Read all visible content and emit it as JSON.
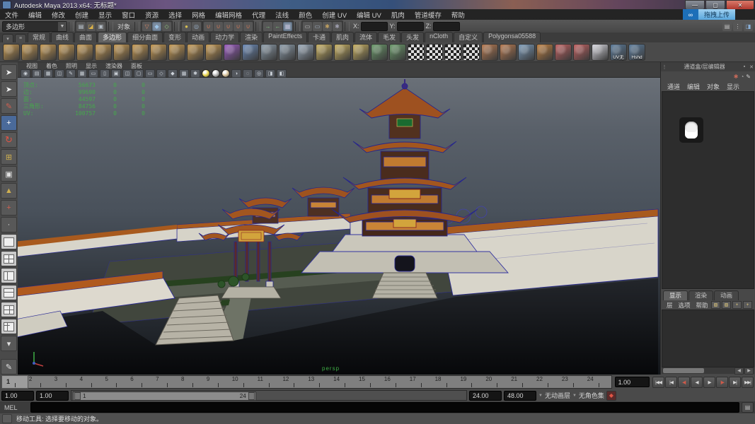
{
  "window": {
    "title": "Autodesk Maya 2013 x64: 无标题*"
  },
  "titlebar_controls": [
    {
      "name": "minimize-button",
      "glyph": "—"
    },
    {
      "name": "maximize-button",
      "glyph": "▢"
    },
    {
      "name": "close-button",
      "glyph": "✕"
    }
  ],
  "upload_button": {
    "label": "拖拽上传"
  },
  "menus": [
    "文件",
    "编辑",
    "修改",
    "创建",
    "显示",
    "窗口",
    "资源",
    "选择",
    "网格",
    "编辑网格",
    "代理",
    "法线",
    "颜色",
    "创建 UV",
    "编辑 UV",
    "肌肉",
    "管道缓存",
    "帮助"
  ],
  "status_line": {
    "menu_set": "多边形",
    "object_mode_label": "对象",
    "file_icons": [
      {
        "name": "new-scene-icon",
        "glyph": "▤",
        "c": "#c8d2dc"
      },
      {
        "name": "open-scene-icon",
        "glyph": "◪",
        "c": "#d9b24a"
      },
      {
        "name": "save-scene-icon",
        "glyph": "▣",
        "c": "#b8c0c8"
      }
    ],
    "mode_icons": [
      {
        "name": "select-by-hierarchy-icon",
        "glyph": "▽",
        "c": "#d88a6a",
        "active": false
      },
      {
        "name": "select-by-object-icon",
        "glyph": "◆",
        "c": "#9cc4e8",
        "active": true
      },
      {
        "name": "select-by-component-icon",
        "glyph": "◇",
        "c": "#8cc47c",
        "active": false
      }
    ],
    "lock_icons": [
      {
        "name": "lock-selection-icon",
        "glyph": "●",
        "c": "#d8c050",
        "active": false
      },
      {
        "name": "highlight-selection-icon",
        "glyph": "◎",
        "c": "#9ab0c8",
        "active": false
      }
    ],
    "snap_icons": [
      {
        "name": "snap-to-grid-icon",
        "glyph": "∪",
        "c": "#d07858",
        "active": false
      },
      {
        "name": "snap-to-curve-icon",
        "glyph": "∪",
        "c": "#d07858",
        "active": false
      },
      {
        "name": "snap-to-point-icon",
        "glyph": "∪",
        "c": "#d07858",
        "active": false
      },
      {
        "name": "snap-to-view-plane-icon",
        "glyph": "∪",
        "c": "#d07858",
        "active": false
      },
      {
        "name": "snap-to-surface-icon",
        "glyph": "∪",
        "c": "#d07858",
        "active": false
      }
    ],
    "history_icons": [
      {
        "name": "input-connections-icon",
        "glyph": "→",
        "c": "#7ec87e",
        "active": false
      },
      {
        "name": "output-connections-icon",
        "glyph": "←",
        "c": "#7ec87e",
        "active": false
      },
      {
        "name": "construction-history-icon",
        "glyph": "▦",
        "c": "#c0c0d8",
        "active": true
      }
    ],
    "render_icons": [
      {
        "name": "render-current-frame-icon",
        "glyph": "▭",
        "c": "#c8c8c8",
        "active": false
      },
      {
        "name": "ipr-render-icon",
        "glyph": "▭",
        "c": "#a8b8c8",
        "active": false
      },
      {
        "name": "render-settings-icon",
        "glyph": "✱",
        "c": "#c0a060",
        "active": false
      },
      {
        "name": "paint-effects-panel-icon",
        "glyph": "✱",
        "c": "#a0a0b0",
        "active": false
      }
    ],
    "coord_fields": [
      {
        "name": "x-coordinate-field",
        "label": "X:"
      },
      {
        "name": "y-coordinate-field",
        "label": "Y:"
      },
      {
        "name": "z-coordinate-field",
        "label": "Z:"
      }
    ],
    "right_icons": [
      {
        "name": "tool-settings-toggle-icon",
        "glyph": "▤",
        "c": "#c0c0c0",
        "active": false
      },
      {
        "name": "channel-layout-icon",
        "glyph": "⋮",
        "c": "#c0c0c0",
        "active": false
      },
      {
        "name": "attribute-editor-toggle-icon",
        "glyph": "◨",
        "c": "#8ab0d8",
        "active": false
      }
    ]
  },
  "shelf": {
    "active": "多边形",
    "tabs": [
      "常规",
      "曲线",
      "曲面",
      "多边形",
      "细分曲面",
      "变形",
      "动画",
      "动力学",
      "渲染",
      "PaintEffects",
      "卡通",
      "肌肉",
      "流体",
      "毛发",
      "头发",
      "nCloth",
      "自定义",
      "Polygonsa05588"
    ],
    "mini_buttons": [
      {
        "name": "shelf-tab-menu-icon",
        "glyph": "▾"
      },
      {
        "name": "shelf-edit-menu-icon",
        "glyph": "≡"
      }
    ],
    "icons": [
      {
        "name": "poly-sphere-icon",
        "c": "#c79a52"
      },
      {
        "name": "poly-cube-icon",
        "c": "#c79a52"
      },
      {
        "name": "poly-cylinder-icon",
        "c": "#c79a52"
      },
      {
        "name": "poly-cone-icon",
        "c": "#c79a52"
      },
      {
        "name": "poly-plane-icon",
        "c": "#c79a52"
      },
      {
        "name": "poly-torus-icon",
        "c": "#c79a52"
      },
      {
        "name": "poly-prism-icon",
        "c": "#c79a52"
      },
      {
        "name": "poly-pyramid-icon",
        "c": "#c79a52"
      },
      {
        "name": "poly-pipe-icon",
        "c": "#c79a52"
      },
      {
        "name": "poly-helix-icon",
        "c": "#c79a52"
      },
      {
        "name": "poly-soccer-ball-icon",
        "c": "#c79a52"
      },
      {
        "name": "poly-platonic-icon",
        "c": "#c79a52"
      },
      {
        "name": "smooth-mesh-icon",
        "c": "#9a5ac0"
      },
      {
        "name": "subdiv-proxy-icon",
        "c": "#6a8ab8"
      },
      {
        "name": "combine-icon",
        "c": "#8a9aa8"
      },
      {
        "name": "separate-icon",
        "c": "#8a9aa8"
      },
      {
        "name": "extract-icon",
        "c": "#98a8b8"
      },
      {
        "name": "boolean-union-icon",
        "c": "#c8b060"
      },
      {
        "name": "boolean-difference-icon",
        "c": "#c8b060"
      },
      {
        "name": "boolean-intersection-icon",
        "c": "#c8b060"
      },
      {
        "name": "triangulate-icon",
        "c": "#6a9a6a"
      },
      {
        "name": "quadrangulate-icon",
        "c": "#6a9a6a"
      },
      {
        "name": "uv-checker-a-icon",
        "c": "checker"
      },
      {
        "name": "uv-checker-b-icon",
        "c": "checker"
      },
      {
        "name": "uv-checker-c-icon",
        "c": "checker"
      },
      {
        "name": "uv-checker-d-icon",
        "c": "checker"
      },
      {
        "name": "mirror-geometry-icon",
        "c": "#b87a50"
      },
      {
        "name": "bevel-icon",
        "c": "#b87a50"
      },
      {
        "name": "bridge-icon",
        "c": "#7a9ab8"
      },
      {
        "name": "extrude-icon",
        "c": "#c08040"
      },
      {
        "name": "split-polygon-icon",
        "c": "#c06060"
      },
      {
        "name": "insert-edge-loop-icon",
        "c": "#c06060"
      },
      {
        "name": "sculpt-geometry-icon",
        "c": "#d8d8e0"
      },
      {
        "name": "uv-snapshot-icon",
        "c": "#5a7a9a",
        "label": "UV无"
      },
      {
        "name": "hypershade-icon",
        "c": "#5a7a9a",
        "label": "Hshd"
      }
    ]
  },
  "toolbox": {
    "tools": [
      {
        "name": "select-tool",
        "glyph": "➤",
        "cls": "sel"
      },
      {
        "name": "lasso-select-tool",
        "glyph": "➤",
        "cls": "sel"
      },
      {
        "name": "paint-select-tool",
        "glyph": "✎",
        "cls": "red"
      },
      {
        "name": "move-tool",
        "glyph": "+",
        "cls": "move"
      },
      {
        "name": "rotate-tool",
        "glyph": "↻",
        "cls": "rot"
      },
      {
        "name": "scale-tool",
        "glyph": "⊞",
        "cls": "scl"
      },
      {
        "name": "universal-manipulator-tool",
        "glyph": "▣",
        "cls": ""
      },
      {
        "name": "soft-modification-tool",
        "glyph": "▲",
        "cls": "scl"
      },
      {
        "name": "show-manipulator-tool",
        "glyph": "+",
        "cls": "red"
      },
      {
        "name": "last-tool-used",
        "glyph": "·",
        "cls": ""
      }
    ],
    "layouts": [
      {
        "name": "layout-single-pane",
        "p": "p1"
      },
      {
        "name": "layout-four-pane",
        "p": "p2"
      },
      {
        "name": "layout-persp-outliner",
        "p": "p3"
      },
      {
        "name": "layout-persp-graph",
        "p": "p4"
      },
      {
        "name": "layout-hypershade-persp",
        "p": "p5"
      },
      {
        "name": "layout-persp-multi",
        "p": "p6"
      }
    ],
    "extra": [
      {
        "name": "layout-shortcuts-menu",
        "glyph": "▾"
      },
      {
        "name": "sculpt-brush-icon",
        "glyph": "✎"
      }
    ]
  },
  "viewport": {
    "panel_menus": [
      "视图",
      "着色",
      "照明",
      "显示",
      "渲染器",
      "面板"
    ],
    "toolbar_icons": [
      {
        "name": "camera-select-icon",
        "g": "◉"
      },
      {
        "name": "camera-bookmark-icon",
        "g": "▤"
      },
      {
        "name": "image-plane-icon",
        "g": "▦"
      },
      {
        "name": "2d-pan-zoom-icon",
        "g": "◫"
      },
      {
        "name": "grease-pencil-icon",
        "g": "✎"
      },
      {
        "name": "grid-display-icon",
        "g": "▦"
      },
      {
        "name": "film-gate-icon",
        "g": "▭"
      },
      {
        "name": "resolution-gate-icon",
        "g": "▯"
      },
      {
        "name": "gate-mask-icon",
        "g": "▣"
      },
      {
        "name": "field-chart-icon",
        "g": "◫"
      },
      {
        "name": "safe-action-icon",
        "g": "▢"
      },
      {
        "name": "safe-title-icon",
        "g": "▭"
      },
      {
        "name": "wireframe-mode-icon",
        "g": "◇"
      },
      {
        "name": "shaded-mode-icon",
        "g": "◆"
      },
      {
        "name": "textured-mode-icon",
        "g": "▩"
      },
      {
        "name": "use-all-lights-icon",
        "g": "✱"
      },
      {
        "name": "default-light-icon",
        "g": "",
        "ball": "#e8d44c"
      },
      {
        "name": "flat-lighting-icon",
        "g": "",
        "ball": "#b6b6b6"
      },
      {
        "name": "textured-light-icon",
        "g": "",
        "ball": "#d8c29a"
      },
      {
        "name": "shadows-icon",
        "g": "◑"
      },
      {
        "name": "xray-icon",
        "g": "◌"
      },
      {
        "name": "isolate-select-icon",
        "g": "◎"
      },
      {
        "name": "exposure-icon",
        "g": "◨"
      },
      {
        "name": "gamma-icon",
        "g": "◧"
      }
    ],
    "camera_label": "persp"
  },
  "hud": {
    "rows": [
      {
        "label": "顶点:",
        "v1": "56673",
        "v2": "0",
        "v3": "0"
      },
      {
        "label": "边:",
        "v1": "99690",
        "v2": "0",
        "v3": "0"
      },
      {
        "label": "面:",
        "v1": "44597",
        "v2": "0",
        "v3": "0"
      },
      {
        "label": "三角形:",
        "v1": "84756",
        "v2": "0",
        "v3": "0"
      },
      {
        "label": "UV:",
        "v1": "100757",
        "v2": "0",
        "v3": "0"
      }
    ]
  },
  "channel_box": {
    "title": "通道盒/层编辑器",
    "header_icons": [
      {
        "name": "pin-panel-icon",
        "glyph": "▪"
      },
      {
        "name": "close-panel-icon",
        "glyph": "✕"
      }
    ],
    "toolbar_icons": [
      {
        "name": "speed-mode-icon",
        "glyph": "✱",
        "c": "#c86a5a"
      },
      {
        "name": "hyperbolic-icon",
        "glyph": "◔",
        "c": "#a8a8a8"
      },
      {
        "name": "pencil-icon",
        "glyph": "✎",
        "c": "#d0d0d0"
      }
    ],
    "menus": [
      "通道",
      "编辑",
      "对象",
      "显示"
    ]
  },
  "layer_editor": {
    "tabs": [
      "显示",
      "渲染",
      "动画"
    ],
    "active_tab": "显示",
    "menus": [
      "层",
      "选项",
      "帮助"
    ],
    "icons": [
      {
        "name": "layer-move-up-icon",
        "glyph": "▧"
      },
      {
        "name": "layer-empty-icon",
        "glyph": "▨"
      },
      {
        "name": "create-empty-layer-icon",
        "glyph": "+"
      },
      {
        "name": "create-layer-from-selected-icon",
        "glyph": "+"
      }
    ],
    "scroll_arrows": [
      "◀",
      "▶"
    ]
  },
  "timeline": {
    "frames": [
      "1",
      "2",
      "3",
      "4",
      "5",
      "6",
      "7",
      "8",
      "9",
      "10",
      "11",
      "12",
      "13",
      "14",
      "15",
      "16",
      "17",
      "18",
      "19",
      "20",
      "21",
      "22",
      "23",
      "24"
    ],
    "current_frame": "1",
    "current_time": "1.00"
  },
  "range": {
    "anim_start": "1.00",
    "playback_start": "1.00",
    "bar_start": "1",
    "bar_end": "24",
    "playback_end": "24.00",
    "anim_end": "48.00",
    "anim_layer": "无动画层",
    "character_set": "无角色集"
  },
  "playback": {
    "buttons": [
      {
        "name": "go-to-start-button",
        "g": "|◀◀",
        "accent": false
      },
      {
        "name": "step-back-frame-button",
        "g": "|◀",
        "accent": false
      },
      {
        "name": "step-back-key-button",
        "g": "◀|",
        "accent": true
      },
      {
        "name": "play-backwards-button",
        "g": "◀",
        "accent": false
      },
      {
        "name": "play-forwards-button",
        "g": "▶",
        "accent": false
      },
      {
        "name": "step-forward-key-button",
        "g": "|▶",
        "accent": true
      },
      {
        "name": "step-forward-frame-button",
        "g": "▶|",
        "accent": false
      },
      {
        "name": "go-to-end-button",
        "g": "▶▶|",
        "accent": false
      }
    ]
  },
  "command_line": {
    "label": "MEL"
  },
  "help_line": {
    "text": "移动工具: 选择要移动的对象。"
  }
}
